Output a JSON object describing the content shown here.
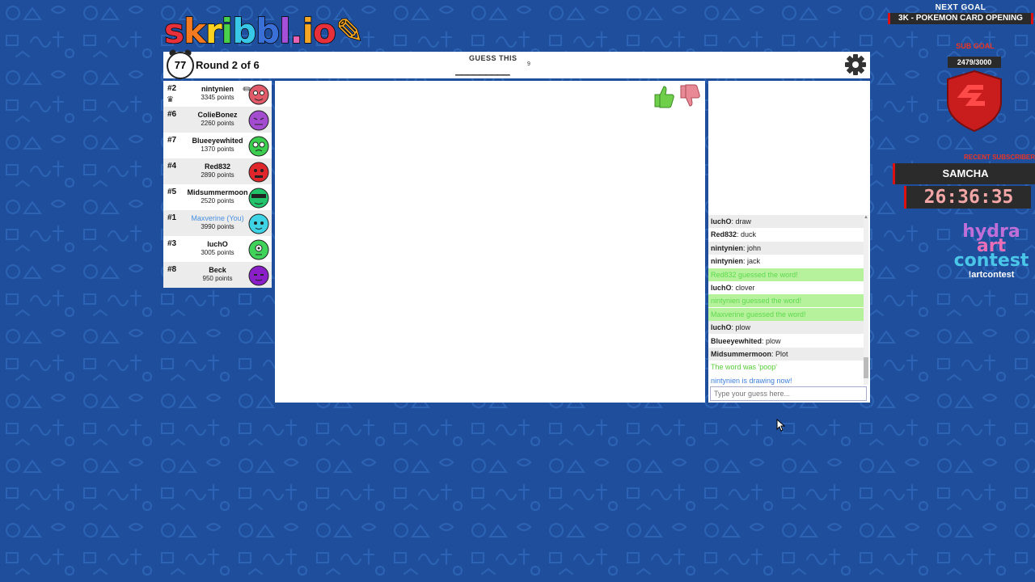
{
  "logo": {
    "text": "skribbl.io"
  },
  "top_bar": {
    "timer": "77",
    "round": "Round 2 of 6",
    "guess_label": "GUESS THIS",
    "hint": "_________",
    "hint_length": "9"
  },
  "players": [
    {
      "rank": "#2",
      "name": "nintynien",
      "points": "3345 points",
      "color": "#e05a6a",
      "drawing": true,
      "owner": true
    },
    {
      "rank": "#6",
      "name": "ColieBonez",
      "points": "2260 points",
      "color": "#a34cd0"
    },
    {
      "rank": "#7",
      "name": "Blueeyewhited",
      "points": "1370 points",
      "color": "#3ccf4f"
    },
    {
      "rank": "#4",
      "name": "Red832",
      "points": "2890 points",
      "color": "#e0262b"
    },
    {
      "rank": "#5",
      "name": "Midsummermoon",
      "points": "2520 points",
      "color": "#22c46b"
    },
    {
      "rank": "#1",
      "name": "Maxverine (You)",
      "points": "3990 points",
      "color": "#3fd3e6",
      "you": true
    },
    {
      "rank": "#3",
      "name": "luchO",
      "points": "3005 points",
      "color": "#3fd35a"
    },
    {
      "rank": "#8",
      "name": "Beck",
      "points": "950 points",
      "color": "#8a1ec9"
    }
  ],
  "chat": {
    "messages": [
      {
        "user": "luchO",
        "text": "draw",
        "style": "alt"
      },
      {
        "user": "Red832",
        "text": "duck",
        "style": "plain"
      },
      {
        "user": "nintynien",
        "text": "john",
        "style": "alt"
      },
      {
        "user": "nintynien",
        "text": "jack",
        "style": "plain"
      },
      {
        "user": "",
        "text": "Red832 guessed the word!",
        "style": "green"
      },
      {
        "user": "luchO",
        "text": "clover",
        "style": "plain"
      },
      {
        "user": "",
        "text": "nintynien guessed the word!",
        "style": "green"
      },
      {
        "user": "",
        "text": "Maxverine guessed the word!",
        "style": "green"
      },
      {
        "user": "luchO",
        "text": "plow",
        "style": "alt"
      },
      {
        "user": "Blueeyewhited",
        "text": "plow",
        "style": "plain"
      },
      {
        "user": "Midsummermoon",
        "text": "Plot",
        "style": "alt"
      },
      {
        "user": "",
        "text": "The word was 'poop'",
        "style": "greentext"
      },
      {
        "user": "",
        "text": "nintynien is drawing now!",
        "style": "blue"
      }
    ],
    "input_placeholder": "Type your guess here..."
  },
  "overlay": {
    "next_goal_label": "NEXT GOAL",
    "next_goal": "3K - POKEMON CARD OPENING",
    "sub_goal_label": "SUB GOAL",
    "sub_goal_count": "2479/3000",
    "recent_sub_label": "RECENT SUBSCRIBER",
    "recent_sub": "SAMCHA",
    "countdown": "26:36:35",
    "contest_line1": "hydra",
    "contest_line2": "art",
    "contest_line3": "contest",
    "contest_command": "!artcontest"
  }
}
